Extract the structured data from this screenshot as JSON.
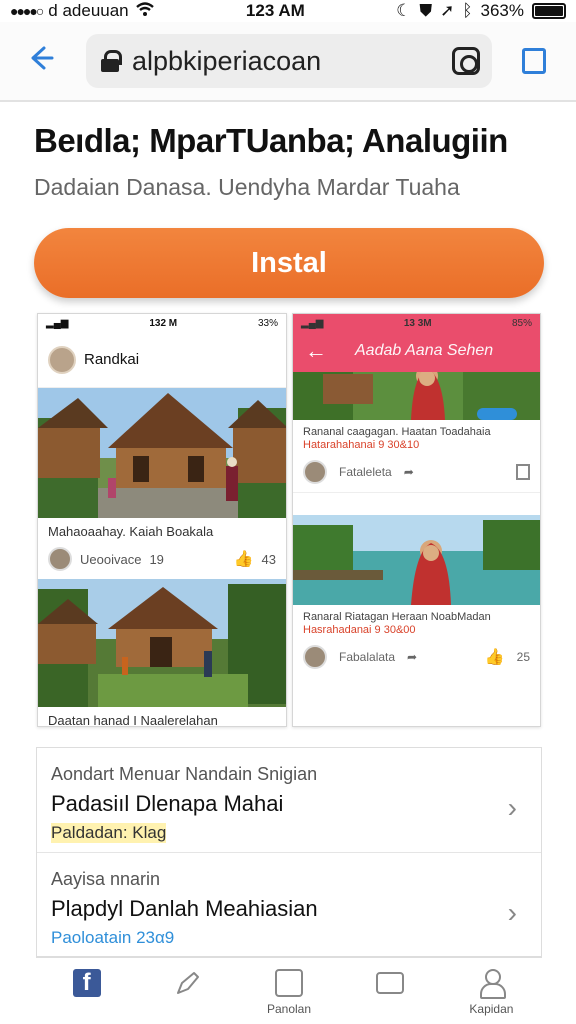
{
  "status_bar": {
    "carrier": "d adeuuan",
    "time": "123 AM",
    "battery": "363%"
  },
  "browser": {
    "url": "alpbkiperiacoan"
  },
  "app": {
    "title": "Beıdla; MparTUanba; Analugiin",
    "subtitle": "Dadaian Danasa. Uendyha Mardar Tuaha",
    "install_label": "Instal"
  },
  "screenshot_left": {
    "time": "132 M",
    "battery": "33%",
    "header_name": "Randkai",
    "post1_caption": "Mahaoaahay. Kaiah Boakala",
    "post1_user": "Ueooivace",
    "post1_num": "19",
    "post1_likes": "43",
    "post2_caption": "Daatan hanad I Naalerelahan"
  },
  "screenshot_right": {
    "time": "13 3M",
    "battery": "85%",
    "header_title": "Aadab Aana Sehen",
    "post1_line1": "Rananal caagagan. Haatan Toadahaia",
    "post1_line2": "Hatarahahanai 9 30&10",
    "post1_user": "Fataleleta",
    "post2_line1": "Ranaral Riatagan Heraan NoabMadan",
    "post2_line2": "Hasrahadanai 9 30&00",
    "post2_user": "Fabalalata",
    "post2_likes": "25"
  },
  "info_list": [
    {
      "label": "Aondart Menuar Nandain Snigian",
      "value": "Padasiıl Dlenapa Mahai",
      "tag": "Paldadan: Klag",
      "tag_color": "#fff2b0"
    },
    {
      "label": "Aayisa nnarin",
      "value": "Plapdyl Danlah Meahiasian",
      "tag": "Paoloatain 23α9",
      "tag_color": "#2f8fd9"
    }
  ],
  "bottom_nav": [
    {
      "icon": "facebook-icon",
      "label": ""
    },
    {
      "icon": "share-icon",
      "label": ""
    },
    {
      "icon": "sparkle-square-icon",
      "label": "Panolan"
    },
    {
      "icon": "chat-bubble-icon",
      "label": ""
    },
    {
      "icon": "profile-icon",
      "label": "Kapidan"
    }
  ],
  "colors": {
    "accent": "#2f7fd9",
    "install": "#ee7731",
    "header_red": "#ea4d6c"
  }
}
